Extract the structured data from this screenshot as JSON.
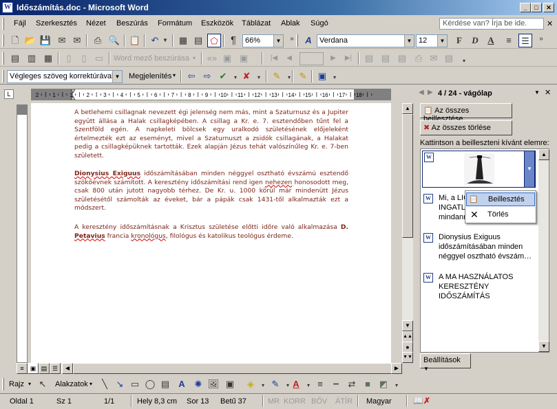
{
  "window": {
    "title": "Időszámítás.doc - Microsoft Word",
    "min": "_",
    "max": "□",
    "close": "✕"
  },
  "menu": [
    "Fájl",
    "Szerkesztés",
    "Nézet",
    "Beszúrás",
    "Formátum",
    "Eszközök",
    "Táblázat",
    "Ablak",
    "Súgó"
  ],
  "help_placeholder": "Kérdése van? Írja be ide.",
  "toolbar": {
    "zoom": "66%",
    "font": "Verdana",
    "size": "12",
    "bold": "F",
    "italic": "D",
    "underline": "A",
    "field_label": "Word mező beszúrása"
  },
  "review": {
    "display_mode": "Végleges szöveg korrektúrával",
    "show_label": "Megjelenítés"
  },
  "document": {
    "p1": "A betlehemi csillagnak nevezett égi jelenség nem más, mint a Szaturnusz és a Jupiter együtt állása a Halak csillagképében. A csillag a Kr. e. 7. esztendőben tűnt fel a Szentföld egén. A napkeleti bölcsek egy uralkodó születésének előjeleként értelmezték ezt az eseményt, mivel a Szaturnuszt a zsidók csillagának, a Halakat pedig a csillagképüknek tartották. Ezek alapján Jézus tehát valószínűleg Kr. e. 7-ben született.",
    "p2_name": "Dionysius Exiguus",
    "p2_a": " időszámításában minden néggyel osztható évszámú esztendő szökőévnek számított. A keresztény időszámítási rend igen ",
    "p2_word": "nehezen",
    "p2_b": " honosodott meg, csak 800 után jutott nagyobb térhez. De Kr. u. 1000 körül már mindenütt Jézus születésétől számolták az éveket, bár a pápák csak 1431-től alkalmazták ezt a módszert.",
    "p3_a": "A keresztény időszámításnak a Krisztus születése előtti időre való alkalmazása ",
    "p3_n1": "D.",
    "p3_n2": "Petavius",
    "p3_b": " francia ",
    "p3_word": "kronológus",
    "p3_c": ", filológus és katolikus teológus érdeme."
  },
  "ruler_numbers": [
    "2",
    "1",
    "1",
    "2",
    "3",
    "4",
    "5",
    "6",
    "7",
    "8",
    "9",
    "10",
    "11",
    "12",
    "13",
    "14",
    "15",
    "16",
    "17",
    "18"
  ],
  "pane": {
    "title": "4 / 24 - vágólap",
    "paste_all": "Az összes beillesztése",
    "clear_all": "Az összes törlése",
    "instruction": "Kattintson a beilleszteni kívánt elemre:",
    "items": [
      "Mi, a LIC... INGATLA... mindann...",
      "Dionysius Exiguus időszámításában minden néggyel osztható évszám…",
      "A MA HASZNÁLATOS KERESZTÉNY IDŐSZÁMÍTÁS"
    ],
    "item1_l1": "Mi, a LIC",
    "item1_l2": "INGATLA",
    "item1_l3": "mindann",
    "options": "Beállítások"
  },
  "context_menu": [
    "Beillesztés",
    "Törlés"
  ],
  "drawing": {
    "draw": "Rajz",
    "autoshapes": "Alakzatok"
  },
  "status": {
    "page": "Oldal 1",
    "section": "Sz 1",
    "pages": "1/1",
    "pos": "Hely 8,3 cm",
    "line": "Sor 13",
    "col": "Betű 37",
    "rec": "MR",
    "trk": "KORR",
    "ext": "BŐV",
    "ovr": "ÁTÍR",
    "lang": "Magyar"
  }
}
